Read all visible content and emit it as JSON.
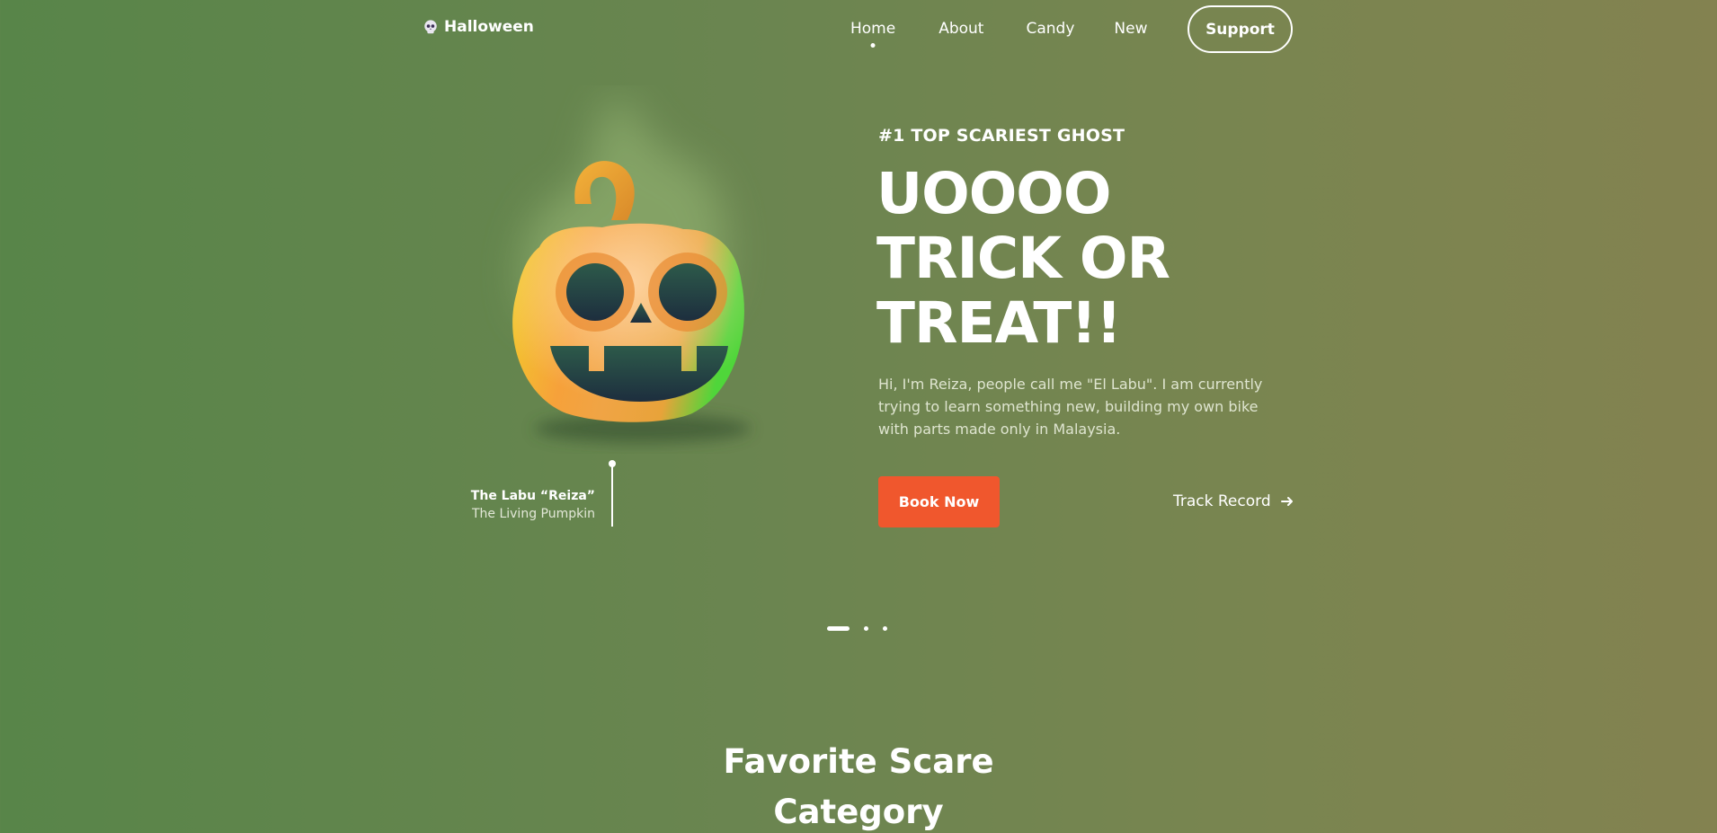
{
  "nav": {
    "logo_text": "Halloween",
    "links": [
      "Home",
      "About",
      "Candy",
      "New"
    ],
    "active": "Home",
    "support_label": "Support"
  },
  "hero": {
    "kicker": "#1 TOP SCARIEST GHOST",
    "headline": [
      "UOOOO",
      "TRICK OR",
      "TREAT!!"
    ],
    "description": "Hi, I'm Reiza, people call me \"El Labu\". I am currently trying to learn something new, building my own bike with parts made only in Malaysia.",
    "book_label": "Book Now",
    "track_label": "Track Record",
    "caption_name": "The Labu “Reiza”",
    "caption_sub": "The Living Pumpkin",
    "image_icon": "jack-o-lantern-icon"
  },
  "slider": {
    "count": 3,
    "active_index": 0
  },
  "section": {
    "title_line1": "Favorite Scare",
    "title_line2": "Category"
  },
  "colors": {
    "accent": "#f0572d",
    "bg_left": "#588549",
    "bg_right": "#838250"
  }
}
